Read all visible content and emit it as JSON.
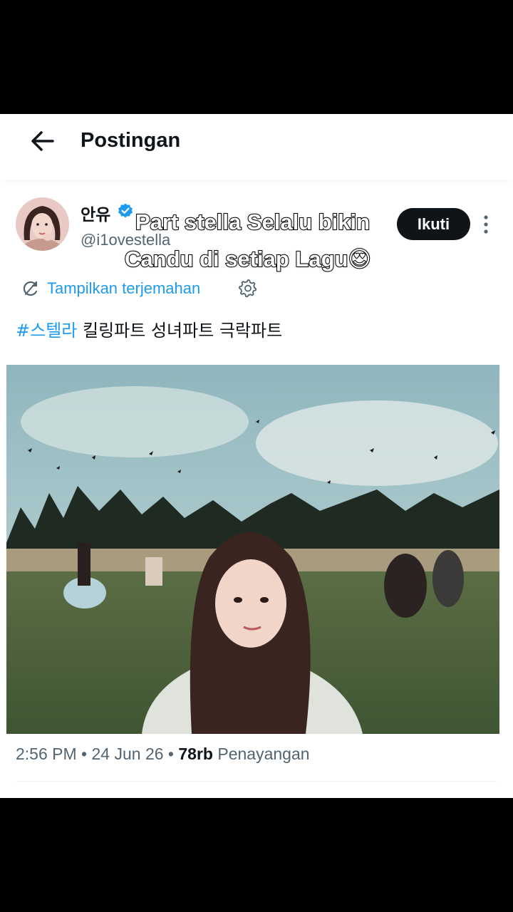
{
  "header": {
    "title": "Postingan"
  },
  "post": {
    "display_name": "안유",
    "handle": "@i1ovestella",
    "follow_label": "Ikuti",
    "translate_label": "Tampilkan terjemahan",
    "hashtag": "#스텔라",
    "body": "킬링파트 성녀파트 극락파트",
    "time": "2:56 PM",
    "date": "24 Jun 26",
    "views_count": "78rb",
    "views_label": "Penayangan",
    "separator": "•"
  },
  "overlay": {
    "line1": "Part stella Selalu bikin",
    "line2": "Candu di setiap Lagu😍"
  },
  "colors": {
    "accent": "#1d9bf0",
    "text": "#0f1419",
    "muted": "#536471",
    "follow_bg": "#0f1419"
  },
  "icons": [
    "back-arrow-icon",
    "verified-badge-icon",
    "more-icon",
    "translate-icon",
    "gear-icon"
  ]
}
